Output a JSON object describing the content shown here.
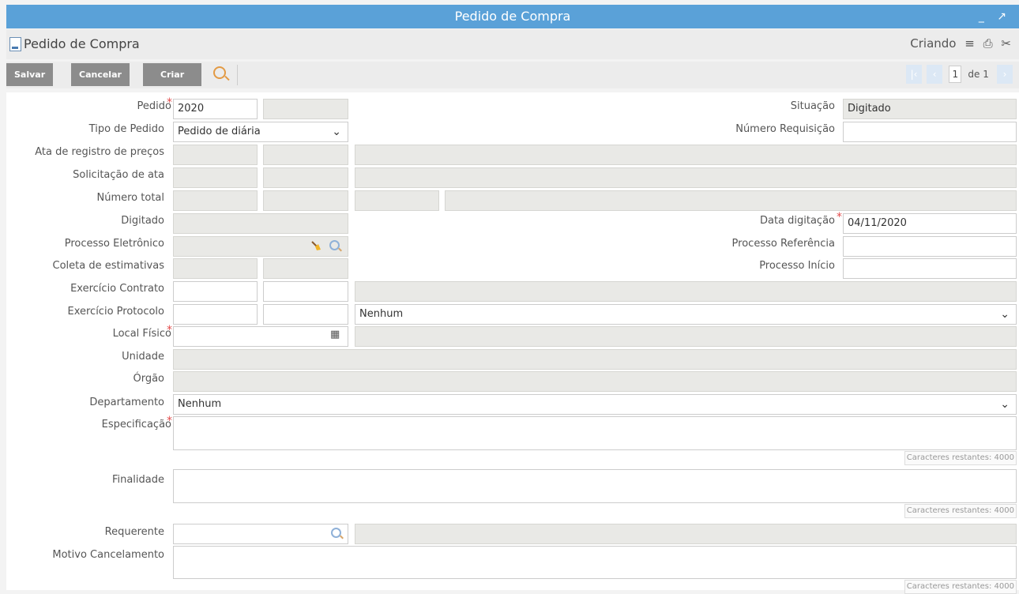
{
  "window": {
    "title": "Pedido de Compra",
    "controls": "_ ↗"
  },
  "header": {
    "title": "Pedido de Compra",
    "status": "Criando"
  },
  "toolbar": {
    "save_label": "Salvar",
    "cancel_label": "Cancelar",
    "create_label": "Criar"
  },
  "pager": {
    "current": "1",
    "of_label": "de 1"
  },
  "form": {
    "pedido": {
      "label": "Pedido",
      "value": "2020"
    },
    "situacao": {
      "label": "Situação",
      "value": "Digitado"
    },
    "tipo_pedido": {
      "label": "Tipo de Pedido",
      "value": "Pedido de diária"
    },
    "numero_requisicao": {
      "label": "Número Requisição"
    },
    "ata_registro": {
      "label": "Ata de registro de preços"
    },
    "solicitacao_ata": {
      "label": "Solicitação de ata"
    },
    "numero_total": {
      "label": "Número total"
    },
    "digitado": {
      "label": "Digitado"
    },
    "data_digitacao": {
      "label": "Data digitação",
      "value": "04/11/2020"
    },
    "processo_eletronico": {
      "label": "Processo Eletrônico"
    },
    "processo_referencia": {
      "label": "Processo Referência"
    },
    "coleta_estimativas": {
      "label": "Coleta de estimativas"
    },
    "processo_inicio": {
      "label": "Processo Início"
    },
    "exercicio_contrato": {
      "label": "Exercício Contrato"
    },
    "exercicio_protocolo": {
      "label": "Exercício Protocolo",
      "select_value": "Nenhum"
    },
    "local_fisico": {
      "label": "Local Físico"
    },
    "unidade": {
      "label": "Unidade"
    },
    "orgao": {
      "label": "Órgão"
    },
    "departamento": {
      "label": "Departamento",
      "value": "Nenhum"
    },
    "especificacao": {
      "label": "Especificação",
      "counter": "Caracteres restantes: 4000"
    },
    "finalidade": {
      "label": "Finalidade",
      "counter": "Caracteres restantes: 4000"
    },
    "requerente": {
      "label": "Requerente"
    },
    "motivo_cancelamento": {
      "label": "Motivo Cancelamento",
      "counter": "Caracteres restantes: 4000"
    }
  }
}
